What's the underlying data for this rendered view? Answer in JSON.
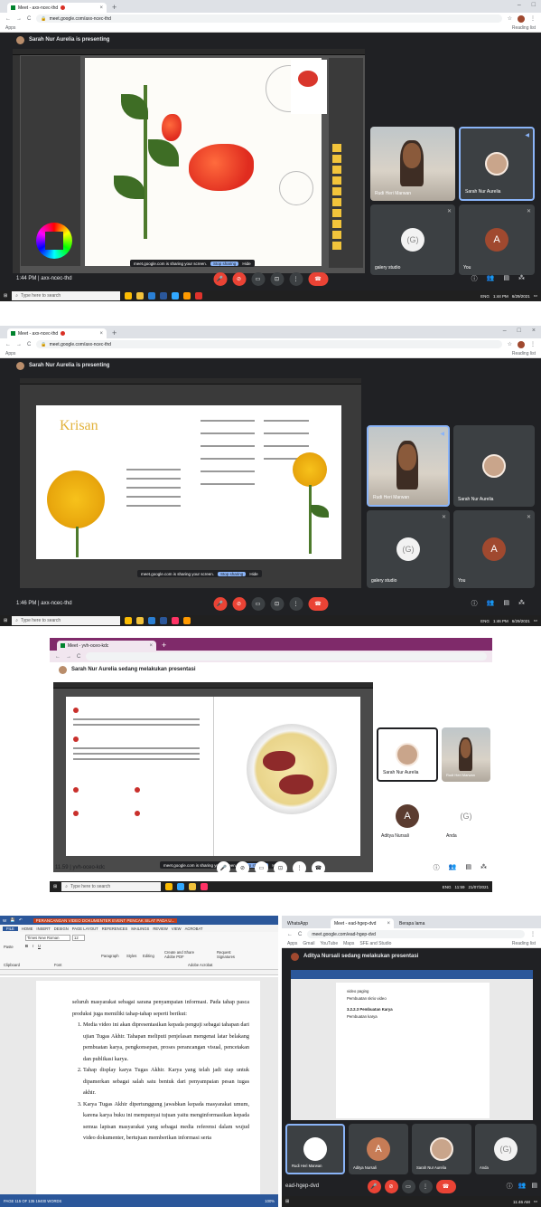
{
  "panel1": {
    "tab_title": "Meet - axx-ncec-thd",
    "url": "meet.google.com/axx-ncec-thd",
    "bookmark": "Apps",
    "reading_list": "Reading list",
    "presenter_text": "Sarah Nur Aurelia is presenting",
    "share_toast": "meet.google.com is sharing your screen.",
    "stop_sharing": "Stop sharing",
    "hide": "Hide",
    "tiles": [
      {
        "name": "Rudi Heri Marwan"
      },
      {
        "name": "Sarah Nur Aurelia"
      },
      {
        "name": "galery studio"
      },
      {
        "name": "You",
        "initial": "A"
      }
    ],
    "time_code": "1:44 PM | axx-ncec-thd",
    "taskbar_search": "Type here to search",
    "clock": "1:44 PM",
    "date": "6/29/2021",
    "lang": "ENG"
  },
  "panel2": {
    "tab_title": "Meet - axx-ncec-thd",
    "url": "meet.google.com/axx-ncec-thd",
    "bookmark": "Apps",
    "reading_list": "Reading list",
    "presenter_text": "Sarah Nur Aurelia is presenting",
    "doc_title": "Krisan",
    "share_toast": "meet.google.com is sharing your screen.",
    "stop_sharing": "Stop sharing",
    "hide": "Hide",
    "tiles": [
      {
        "name": "Rudi Heri Marwan"
      },
      {
        "name": "Sarah Nur Aurelia"
      },
      {
        "name": "galery studio"
      },
      {
        "name": "You",
        "initial": "A"
      }
    ],
    "time_code": "1:46 PM | axx-ncec-thd",
    "taskbar_search": "Type here to search",
    "clock": "1:46 PM",
    "date": "6/29/2021",
    "lang": "ENG"
  },
  "panel3": {
    "tab_title": "Meet - yvh-oceo-kdc",
    "presenter_text": "Sarah Nur Aurelia sedang melakukan presentasi",
    "share_toast": "meet.google.com is sharing your screen.",
    "stop_sharing": "Stop sharing",
    "hide": "Hide",
    "tiles": [
      {
        "name": "Sarah Nur Aurelia"
      },
      {
        "name": "Rudi Heri Marwan"
      },
      {
        "name": "Aditya Nursali",
        "initial": "A"
      },
      {
        "name": "Anda"
      }
    ],
    "time_code": "11.59 | yvh-oceo-kdc",
    "taskbar_search": "Type here to search",
    "clock": "11:59",
    "date": "21/07/2021",
    "lang": "ENG"
  },
  "panel4": {
    "word_title": "PERANCANGAN VIDEO DOKUMENTER EVENT PENCAK SILAT PADA U...",
    "menus": [
      "FILE",
      "HOME",
      "INSERT",
      "DESIGN",
      "PAGE LAYOUT",
      "REFERENCES",
      "MAILINGS",
      "REVIEW",
      "VIEW",
      "ACROBAT"
    ],
    "font_name": "Times New Roman",
    "font_size": "12",
    "tools": [
      "Paste",
      "Paragraph",
      "Styles",
      "Editing",
      "Create and Share Adobe PDF",
      "Request Signatures"
    ],
    "tool_groups": [
      "Clipboard",
      "Font",
      "Adobe Acrobat"
    ],
    "paragraph1": "seluruh masyarakat sebagai sarana penyampaian informasi. Pada tahap pasca produksi juga memiliki tahap-tahap seperti berikut:",
    "list": [
      "Media video ini akan dipresentasikan kepada penguji sebagai tahapan dari ujian Tugas Akhir. Tahapan meliputi penjelasan mengenai latar belakang pembuatan karya, pengkonsepan, proses perancangan visual, pencetakan dan publikasi karya.",
      "Tahap display karya Tugas Akhir. Karya yang telah jadi siap untuk dipamerkan sebagai salah satu bentuk dari penyampaian pesan tugas akhir.",
      "Karya Tugas Akhir dipertunggung jawabkan kepada masyarakat umum, karena karya buku ini mempunyai tujuan yaitu menginformasikan kepada semua lapisan masyarakat yang sebagai media referensi dalam wujud video dokumenter, bertujuan memberikan informasi serta"
    ],
    "word_status": "PAGE 115 OF 135    19400 WORDS",
    "zoom": "100%",
    "chrome_tabs": [
      "WhatsApp",
      "Meet - ead-hgep-dvd",
      "Berapa lama"
    ],
    "url": "meet.google.com/ead-hgep-dvd",
    "bookmarks": [
      "Apps",
      "Gmail",
      "YouTube",
      "Maps",
      "SFE and Studio"
    ],
    "reading_list": "Reading list",
    "presenter_text": "Aditya Nursali sedang melakukan presentasi",
    "doc_heading": "3.2.2.3 Pembuatan Karya",
    "doc_lines": [
      "video paging",
      "Pembuatan skrio video",
      "Pembuatan karya"
    ],
    "tiles": [
      {
        "name": "Rudi Heri Marwan"
      },
      {
        "name": "Aditya Nursali",
        "initial": "A"
      },
      {
        "name": "Sarah Nur Aurelia"
      },
      {
        "name": "Anda"
      }
    ],
    "meet_code": "ead-hgep-dvd",
    "clock": "11:46 AM"
  },
  "colors": {
    "meet_bg": "#202124",
    "tile_bg": "#3c4043",
    "end_call": "#ea4335",
    "word_blue": "#2b579a",
    "krisan_gold": "#e2b23a"
  }
}
